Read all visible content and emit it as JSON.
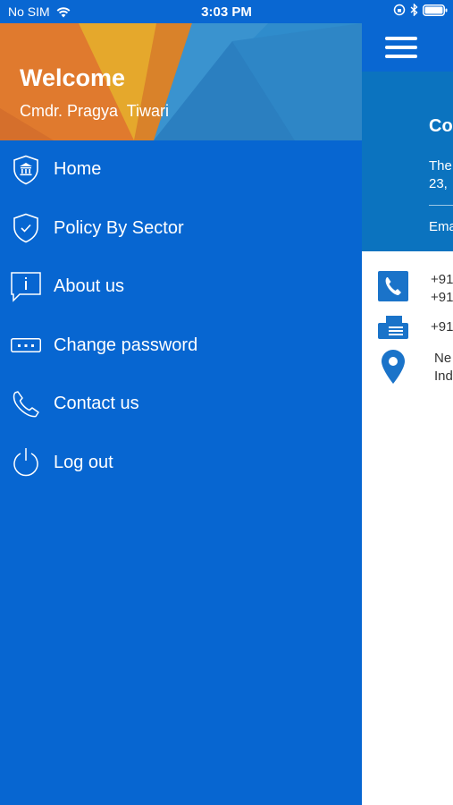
{
  "status_bar": {
    "carrier": "No SIM",
    "time": "3:03 PM"
  },
  "drawer": {
    "welcome": "Welcome",
    "username": "Cmdr. Pragya  Tiwari",
    "menu": [
      {
        "label": "Home",
        "icon": "shield-home-icon"
      },
      {
        "label": "Policy By Sector",
        "icon": "shield-check-icon"
      },
      {
        "label": "About us",
        "icon": "info-bubble-icon"
      },
      {
        "label": "Change password",
        "icon": "password-dots-icon"
      },
      {
        "label": "Contact us",
        "icon": "phone-icon"
      },
      {
        "label": "Log out",
        "icon": "power-icon"
      }
    ]
  },
  "background_page": {
    "card_title": "Co",
    "address_line1": "The",
    "address_line2": "23,",
    "email_label": "Ema",
    "phone_line1": "+91",
    "phone_line2": "+91",
    "fax": "+91",
    "location_line1": "Ne",
    "location_line2": "Ind"
  },
  "colors": {
    "primary_blue": "#0766d1",
    "status_bar": "#0967d2",
    "card_blue": "#0b73bf",
    "header_orange": "#e07a2e",
    "header_yellow": "#e5a82c"
  }
}
